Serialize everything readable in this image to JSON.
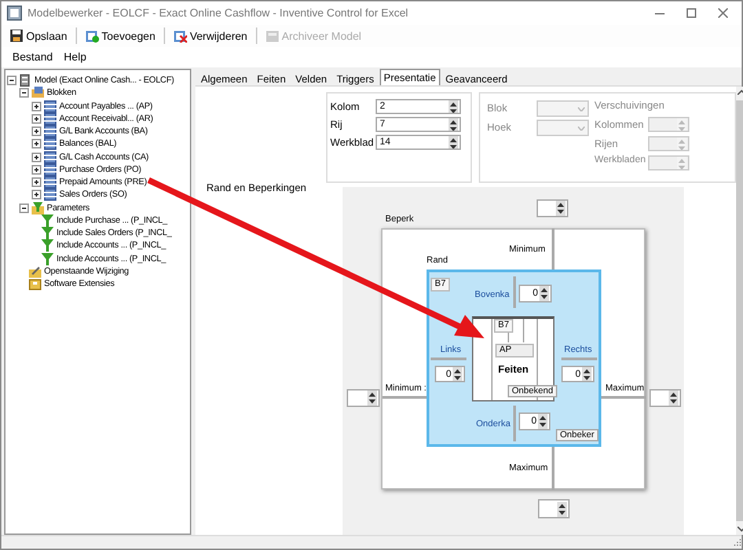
{
  "window": {
    "title": "Modelbewerker - EOLCF - Exact Online Cashflow - Inventive Control for Excel"
  },
  "toolbar": [
    {
      "label": "Opslaan",
      "kind": "save",
      "disabled": false
    },
    {
      "label": "Toevoegen",
      "kind": "add",
      "disabled": false
    },
    {
      "label": "Verwijderen",
      "kind": "delete",
      "disabled": false
    },
    {
      "label": "Archiveer Model",
      "kind": "archive",
      "disabled": true
    }
  ],
  "menu": [
    "Bestand",
    "Help"
  ],
  "tree": [
    {
      "label": "Model (Exact Online Cash... - EOLCF)",
      "kind": "model",
      "expanded": true,
      "children": [
        {
          "label": "Blokken",
          "kind": "blocks",
          "expanded": true,
          "children": [
            {
              "label": "Account Payables ... (AP)",
              "kind": "block",
              "expanded": false
            },
            {
              "label": "Account Receivabl... (AR)",
              "kind": "block",
              "expanded": false
            },
            {
              "label": "G/L Bank Accounts (BA)",
              "kind": "block",
              "expanded": false
            },
            {
              "label": "Balances (BAL)",
              "kind": "block",
              "expanded": false
            },
            {
              "label": "G/L Cash Accounts (CA)",
              "kind": "block",
              "expanded": false
            },
            {
              "label": "Purchase Orders (PO)",
              "kind": "block",
              "expanded": false
            },
            {
              "label": "Prepaid Amounts (PRE)",
              "kind": "block",
              "expanded": false
            },
            {
              "label": "Sales Orders (SO)",
              "kind": "block",
              "expanded": false
            }
          ]
        },
        {
          "label": "Parameters",
          "kind": "parameters",
          "expanded": true,
          "children": [
            {
              "label": "Include Purchase ... (P_INCL_",
              "kind": "parameter"
            },
            {
              "label": "Include Sales Orders (P_INCL_",
              "kind": "parameter"
            },
            {
              "label": "Include Accounts ... (P_INCL_",
              "kind": "parameter"
            },
            {
              "label": "Include Accounts ... (P_INCL_",
              "kind": "parameter"
            }
          ]
        },
        {
          "label": "Openstaande Wijziging",
          "kind": "changes"
        },
        {
          "label": "Software Extensies",
          "kind": "extensions"
        }
      ]
    }
  ],
  "tabs": [
    {
      "label": "Algemeen",
      "selected": false
    },
    {
      "label": "Feiten",
      "selected": false
    },
    {
      "label": "Velden",
      "selected": false
    },
    {
      "label": "Triggers",
      "selected": false
    },
    {
      "label": "Presentatie",
      "selected": true
    },
    {
      "label": "Geavanceerd",
      "selected": false
    }
  ],
  "position": [
    {
      "label": "Kolom",
      "value": "2"
    },
    {
      "label": "Rij",
      "value": "7"
    },
    {
      "label": "Werkblad",
      "value": "14"
    }
  ],
  "anchor": [
    {
      "label": "Blok",
      "disabled": true
    },
    {
      "label": "Hoek",
      "disabled": true
    }
  ],
  "offsets": {
    "heading": "Verschuivingen",
    "fields": [
      {
        "label": "Kolommen",
        "disabled": true
      },
      {
        "label": "Rijen",
        "disabled": true
      },
      {
        "label": "Werkbladen",
        "disabled": true
      }
    ]
  },
  "section_label": "Rand en Beperkingen",
  "diagram": {
    "beperk_label": "Beperk",
    "top_minimum": "Minimum",
    "rand_label": "Rand",
    "rand_cell": "B7",
    "top": {
      "label": "Bovenka",
      "value": "0"
    },
    "left": {
      "label": "Links",
      "value": "0"
    },
    "right": {
      "label": "Rechts",
      "value": "0"
    },
    "bottom": {
      "label": "Onderka",
      "value": "0"
    },
    "rand_button": "Onbeker",
    "block": {
      "cell": "B7",
      "name": "AP",
      "type": "Feiten",
      "button": "Onbekend"
    },
    "left_minimum": "Minimum :",
    "right_maximum": "Maximum",
    "bottom_maximum": "Maximum"
  }
}
